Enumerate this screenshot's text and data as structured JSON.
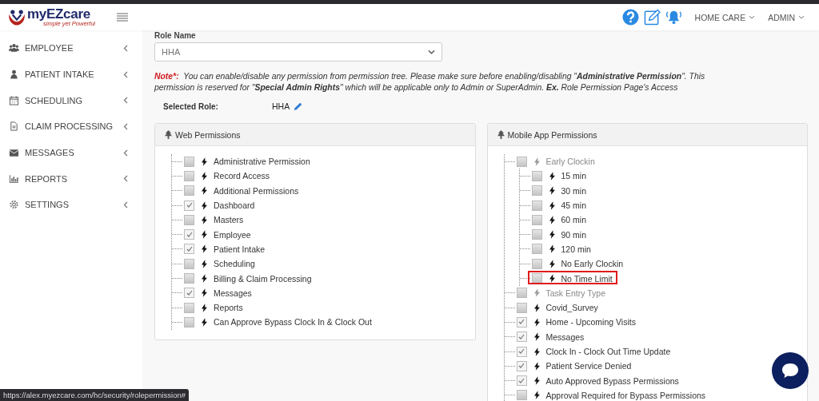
{
  "header": {
    "logo": "myEZcare",
    "tagline": "simple yet Powerful",
    "menus": [
      {
        "label": "HOME CARE"
      },
      {
        "label": "ADMIN"
      }
    ]
  },
  "sidebar": {
    "items": [
      {
        "label": "EMPLOYEE"
      },
      {
        "label": "PATIENT INTAKE"
      },
      {
        "label": "SCHEDULING"
      },
      {
        "label": "CLAIM PROCESSING"
      },
      {
        "label": "MESSAGES"
      },
      {
        "label": "REPORTS"
      },
      {
        "label": "SETTINGS"
      }
    ]
  },
  "role_name": {
    "label": "Role Name",
    "value": "HHA"
  },
  "note": {
    "label": "Note*:",
    "text": "You can enable/disable any permission from permission tree. Please make sure before enabling/disabling \"**Administrative Permission**\". This permission is reserved for \"**Special Admin Rights**\" which will be applicable only to Admin or SuperAdmin. **Ex.** Role Permission Page's Access"
  },
  "selected_role": {
    "label": "Selected Role:",
    "value": "HHA"
  },
  "panels": [
    {
      "title": "Web Permissions",
      "items": [
        {
          "label": "Administrative Permission",
          "checked": false,
          "disabled": false,
          "highlighted": false
        },
        {
          "label": "Record Access",
          "checked": false,
          "disabled": false,
          "highlighted": false
        },
        {
          "label": "Additional Permissions",
          "checked": false,
          "disabled": false,
          "highlighted": false
        },
        {
          "label": "Dashboard",
          "checked": true,
          "disabled": false,
          "highlighted": false
        },
        {
          "label": "Masters",
          "checked": false,
          "disabled": false,
          "highlighted": false
        },
        {
          "label": "Employee",
          "checked": true,
          "disabled": false,
          "highlighted": false
        },
        {
          "label": "Patient Intake",
          "checked": true,
          "disabled": false,
          "highlighted": false
        },
        {
          "label": "Scheduling",
          "checked": false,
          "disabled": false,
          "highlighted": false
        },
        {
          "label": "Billing & Claim Processing",
          "checked": false,
          "disabled": false,
          "highlighted": false
        },
        {
          "label": "Messages",
          "checked": true,
          "disabled": false,
          "highlighted": false
        },
        {
          "label": "Reports",
          "checked": false,
          "disabled": false,
          "highlighted": false
        },
        {
          "label": "Can Approve Bypass Clock In & Clock Out",
          "checked": false,
          "disabled": false,
          "highlighted": false
        }
      ]
    },
    {
      "title": "Mobile App Permissions",
      "items": [
        {
          "label": "Early Clockin",
          "checked": false,
          "disabled": true,
          "highlighted": false,
          "expanded": true,
          "children": [
            {
              "label": "15 min",
              "checked": false,
              "disabled": false,
              "highlighted": false
            },
            {
              "label": "30 min",
              "checked": false,
              "disabled": false,
              "highlighted": false
            },
            {
              "label": "45 min",
              "checked": false,
              "disabled": false,
              "highlighted": false
            },
            {
              "label": "60 min",
              "checked": false,
              "disabled": false,
              "highlighted": false
            },
            {
              "label": "90 min",
              "checked": false,
              "disabled": false,
              "highlighted": false
            },
            {
              "label": "120 min",
              "checked": false,
              "disabled": false,
              "highlighted": false
            },
            {
              "label": "No Early Clockin",
              "checked": false,
              "disabled": false,
              "highlighted": false
            },
            {
              "label": "No Time Limit",
              "checked": false,
              "disabled": false,
              "highlighted": true
            }
          ]
        },
        {
          "label": "Task Entry Type",
          "checked": false,
          "disabled": true,
          "highlighted": false
        },
        {
          "label": "Covid_Survey",
          "checked": false,
          "disabled": false,
          "highlighted": false
        },
        {
          "label": "Home - Upcoming Visits",
          "checked": true,
          "disabled": false,
          "highlighted": false
        },
        {
          "label": "Messages",
          "checked": true,
          "disabled": false,
          "highlighted": false
        },
        {
          "label": "Clock In - Clock Out Time Update",
          "checked": true,
          "disabled": false,
          "highlighted": false
        },
        {
          "label": "Patient Service Denied",
          "checked": true,
          "disabled": false,
          "highlighted": false
        },
        {
          "label": "Auto Approved Bypass Permissions",
          "checked": true,
          "disabled": false,
          "highlighted": false
        },
        {
          "label": "Approval Required for Bypass Permissions",
          "checked": false,
          "disabled": false,
          "highlighted": false
        }
      ]
    }
  ],
  "status_bar": {
    "url": "https://alex.myezcare.com/hc/security/rolepermission#"
  }
}
